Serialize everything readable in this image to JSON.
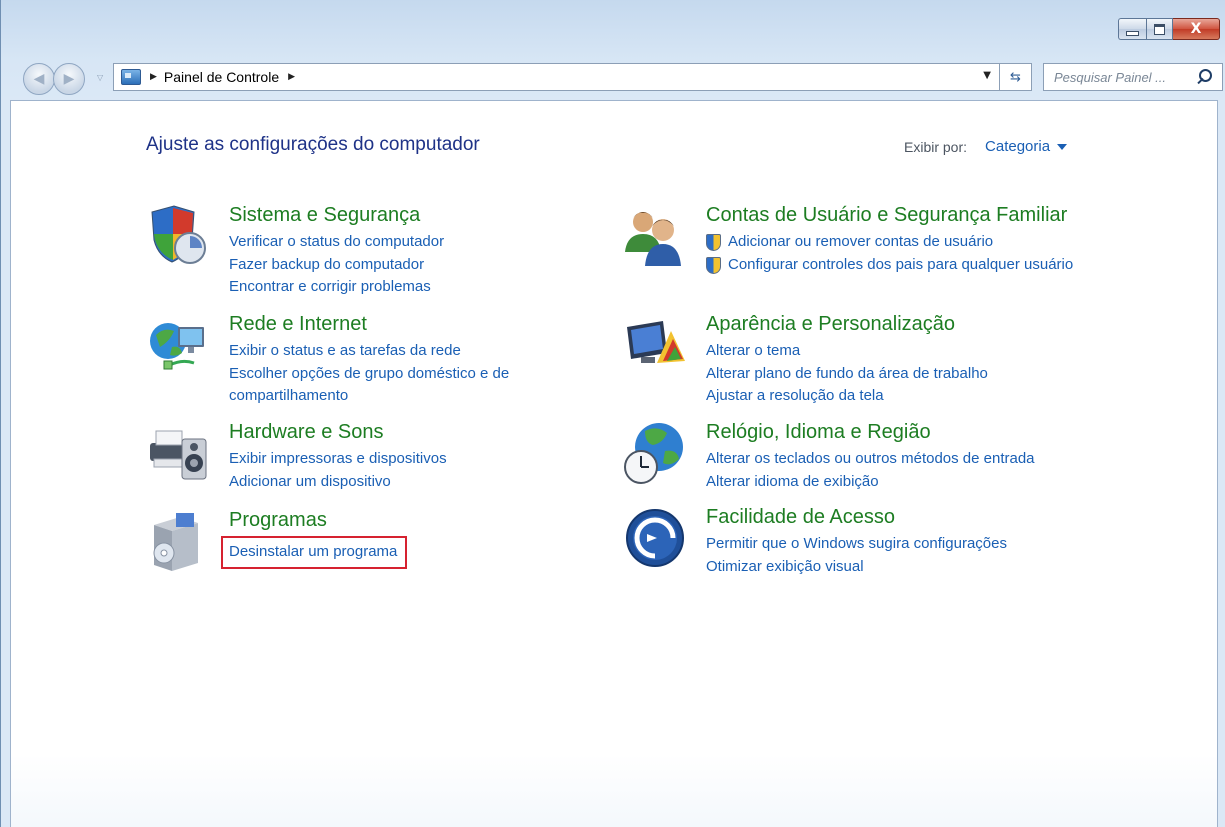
{
  "window": {
    "controls": {
      "minimize": "minimize",
      "maximize": "maximize",
      "close": "X"
    }
  },
  "navigation": {
    "breadcrumb": "Painel de Controle",
    "search_placeholder": "Pesquisar Painel ..."
  },
  "header": {
    "title": "Ajuste as configurações do computador",
    "view_by_label": "Exibir por:",
    "view_by_value": "Categoria"
  },
  "categories": [
    {
      "title": "Sistema e Segurança",
      "icon": "shield-security-icon",
      "links": [
        "Verificar o status do computador",
        "Fazer backup do computador",
        "Encontrar e corrigir problemas"
      ]
    },
    {
      "title": "Rede e Internet",
      "icon": "network-globe-icon",
      "links": [
        "Exibir o status e as tarefas da rede",
        "Escolher opções de grupo doméstico e de compartilhamento"
      ]
    },
    {
      "title": "Hardware e Sons",
      "icon": "printer-speaker-icon",
      "links": [
        "Exibir impressoras e dispositivos",
        "Adicionar um dispositivo"
      ]
    },
    {
      "title": "Programas",
      "icon": "programs-box-icon",
      "links": [
        "Desinstalar um programa"
      ]
    },
    {
      "title": "Contas de Usuário e Segurança Familiar",
      "icon": "users-icon",
      "links": [
        "Adicionar ou remover contas de usuário",
        "Configurar controles dos pais para qualquer usuário"
      ]
    },
    {
      "title": "Aparência e Personalização",
      "icon": "monitor-paint-icon",
      "links": [
        "Alterar o tema",
        "Alterar plano de fundo da área de trabalho",
        "Ajustar a resolução da tela"
      ]
    },
    {
      "title": "Relógio, Idioma e Região",
      "icon": "globe-clock-icon",
      "links": [
        "Alterar os teclados ou outros métodos de entrada",
        "Alterar idioma de exibição"
      ]
    },
    {
      "title": "Facilidade de Acesso",
      "icon": "ease-of-access-icon",
      "links": [
        "Permitir que o Windows sugira configurações",
        "Otimizar exibição visual"
      ]
    }
  ],
  "colors": {
    "category_title": "#1d7d22",
    "link": "#1a5fb4",
    "page_title": "#1e3287",
    "highlight_box": "#d62230"
  }
}
